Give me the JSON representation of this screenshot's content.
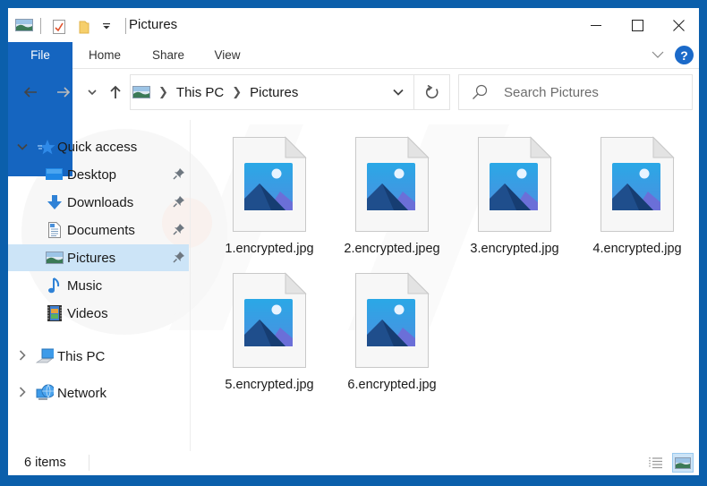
{
  "window": {
    "title": "Pictures",
    "controls": {
      "minimize": "minimize",
      "maximize": "maximize",
      "close": "close"
    }
  },
  "quick_access_toolbar": {
    "icons": [
      "pictures-folder-icon",
      "properties-icon",
      "new-folder-icon",
      "customize-dropdown-icon"
    ]
  },
  "ribbon": {
    "tabs": [
      {
        "label": "File",
        "active": true
      },
      {
        "label": "Home"
      },
      {
        "label": "Share"
      },
      {
        "label": "View"
      }
    ],
    "help_label": "?"
  },
  "navigation": {
    "address": {
      "segments": [
        "This PC",
        "Pictures"
      ],
      "separator": ">"
    },
    "search": {
      "placeholder": "Search Pictures",
      "value": ""
    }
  },
  "sidebar": {
    "quick_access": {
      "label": "Quick access",
      "expanded": true
    },
    "items": [
      {
        "label": "Desktop",
        "icon": "desktop-icon",
        "pinned": true
      },
      {
        "label": "Downloads",
        "icon": "downloads-icon",
        "pinned": true
      },
      {
        "label": "Documents",
        "icon": "documents-icon",
        "pinned": true
      },
      {
        "label": "Pictures",
        "icon": "pictures-icon",
        "pinned": true,
        "selected": true
      },
      {
        "label": "Music",
        "icon": "music-icon",
        "pinned": false
      },
      {
        "label": "Videos",
        "icon": "videos-icon",
        "pinned": false
      }
    ],
    "roots": [
      {
        "label": "This PC",
        "icon": "this-pc-icon",
        "expanded": false
      },
      {
        "label": "Network",
        "icon": "network-icon",
        "expanded": false
      }
    ]
  },
  "files": [
    {
      "name": "1.encrypted.jpg"
    },
    {
      "name": "2.encrypted.jpeg"
    },
    {
      "name": "3.encrypted.jpg"
    },
    {
      "name": "4.encrypted.jpg"
    },
    {
      "name": "5.encrypted.jpg"
    },
    {
      "name": "6.encrypted.jpg"
    }
  ],
  "status": {
    "item_count": "6 items",
    "view_modes": [
      {
        "name": "details-view",
        "active": false
      },
      {
        "name": "large-icons-view",
        "active": true
      }
    ]
  },
  "colors": {
    "window_border": "#0b5fab",
    "file_tab": "#1565c0",
    "selection": "#cce4f7",
    "help_button": "#1b6ac9"
  }
}
